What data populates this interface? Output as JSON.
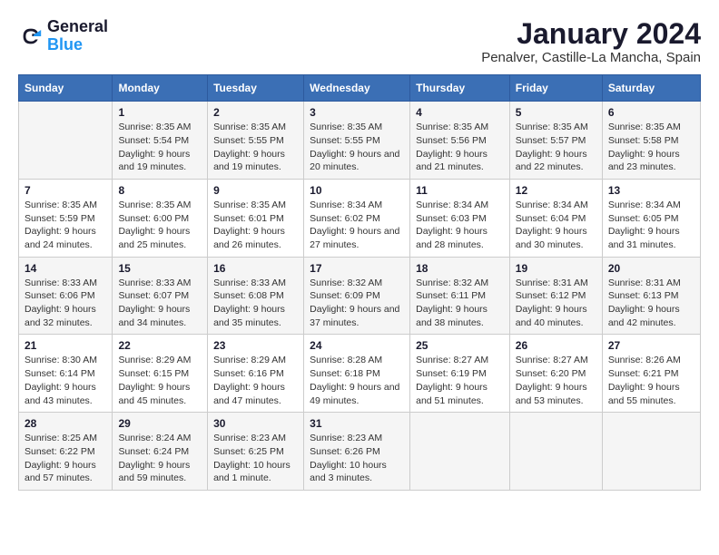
{
  "header": {
    "logo_general": "General",
    "logo_blue": "Blue",
    "title": "January 2024",
    "location": "Penalver, Castille-La Mancha, Spain"
  },
  "calendar": {
    "days_of_week": [
      "Sunday",
      "Monday",
      "Tuesday",
      "Wednesday",
      "Thursday",
      "Friday",
      "Saturday"
    ],
    "weeks": [
      [
        {
          "day": "",
          "sunrise": "",
          "sunset": "",
          "daylight": ""
        },
        {
          "day": "1",
          "sunrise": "Sunrise: 8:35 AM",
          "sunset": "Sunset: 5:54 PM",
          "daylight": "Daylight: 9 hours and 19 minutes."
        },
        {
          "day": "2",
          "sunrise": "Sunrise: 8:35 AM",
          "sunset": "Sunset: 5:55 PM",
          "daylight": "Daylight: 9 hours and 19 minutes."
        },
        {
          "day": "3",
          "sunrise": "Sunrise: 8:35 AM",
          "sunset": "Sunset: 5:55 PM",
          "daylight": "Daylight: 9 hours and 20 minutes."
        },
        {
          "day": "4",
          "sunrise": "Sunrise: 8:35 AM",
          "sunset": "Sunset: 5:56 PM",
          "daylight": "Daylight: 9 hours and 21 minutes."
        },
        {
          "day": "5",
          "sunrise": "Sunrise: 8:35 AM",
          "sunset": "Sunset: 5:57 PM",
          "daylight": "Daylight: 9 hours and 22 minutes."
        },
        {
          "day": "6",
          "sunrise": "Sunrise: 8:35 AM",
          "sunset": "Sunset: 5:58 PM",
          "daylight": "Daylight: 9 hours and 23 minutes."
        }
      ],
      [
        {
          "day": "7",
          "sunrise": "Sunrise: 8:35 AM",
          "sunset": "Sunset: 5:59 PM",
          "daylight": "Daylight: 9 hours and 24 minutes."
        },
        {
          "day": "8",
          "sunrise": "Sunrise: 8:35 AM",
          "sunset": "Sunset: 6:00 PM",
          "daylight": "Daylight: 9 hours and 25 minutes."
        },
        {
          "day": "9",
          "sunrise": "Sunrise: 8:35 AM",
          "sunset": "Sunset: 6:01 PM",
          "daylight": "Daylight: 9 hours and 26 minutes."
        },
        {
          "day": "10",
          "sunrise": "Sunrise: 8:34 AM",
          "sunset": "Sunset: 6:02 PM",
          "daylight": "Daylight: 9 hours and 27 minutes."
        },
        {
          "day": "11",
          "sunrise": "Sunrise: 8:34 AM",
          "sunset": "Sunset: 6:03 PM",
          "daylight": "Daylight: 9 hours and 28 minutes."
        },
        {
          "day": "12",
          "sunrise": "Sunrise: 8:34 AM",
          "sunset": "Sunset: 6:04 PM",
          "daylight": "Daylight: 9 hours and 30 minutes."
        },
        {
          "day": "13",
          "sunrise": "Sunrise: 8:34 AM",
          "sunset": "Sunset: 6:05 PM",
          "daylight": "Daylight: 9 hours and 31 minutes."
        }
      ],
      [
        {
          "day": "14",
          "sunrise": "Sunrise: 8:33 AM",
          "sunset": "Sunset: 6:06 PM",
          "daylight": "Daylight: 9 hours and 32 minutes."
        },
        {
          "day": "15",
          "sunrise": "Sunrise: 8:33 AM",
          "sunset": "Sunset: 6:07 PM",
          "daylight": "Daylight: 9 hours and 34 minutes."
        },
        {
          "day": "16",
          "sunrise": "Sunrise: 8:33 AM",
          "sunset": "Sunset: 6:08 PM",
          "daylight": "Daylight: 9 hours and 35 minutes."
        },
        {
          "day": "17",
          "sunrise": "Sunrise: 8:32 AM",
          "sunset": "Sunset: 6:09 PM",
          "daylight": "Daylight: 9 hours and 37 minutes."
        },
        {
          "day": "18",
          "sunrise": "Sunrise: 8:32 AM",
          "sunset": "Sunset: 6:11 PM",
          "daylight": "Daylight: 9 hours and 38 minutes."
        },
        {
          "day": "19",
          "sunrise": "Sunrise: 8:31 AM",
          "sunset": "Sunset: 6:12 PM",
          "daylight": "Daylight: 9 hours and 40 minutes."
        },
        {
          "day": "20",
          "sunrise": "Sunrise: 8:31 AM",
          "sunset": "Sunset: 6:13 PM",
          "daylight": "Daylight: 9 hours and 42 minutes."
        }
      ],
      [
        {
          "day": "21",
          "sunrise": "Sunrise: 8:30 AM",
          "sunset": "Sunset: 6:14 PM",
          "daylight": "Daylight: 9 hours and 43 minutes."
        },
        {
          "day": "22",
          "sunrise": "Sunrise: 8:29 AM",
          "sunset": "Sunset: 6:15 PM",
          "daylight": "Daylight: 9 hours and 45 minutes."
        },
        {
          "day": "23",
          "sunrise": "Sunrise: 8:29 AM",
          "sunset": "Sunset: 6:16 PM",
          "daylight": "Daylight: 9 hours and 47 minutes."
        },
        {
          "day": "24",
          "sunrise": "Sunrise: 8:28 AM",
          "sunset": "Sunset: 6:18 PM",
          "daylight": "Daylight: 9 hours and 49 minutes."
        },
        {
          "day": "25",
          "sunrise": "Sunrise: 8:27 AM",
          "sunset": "Sunset: 6:19 PM",
          "daylight": "Daylight: 9 hours and 51 minutes."
        },
        {
          "day": "26",
          "sunrise": "Sunrise: 8:27 AM",
          "sunset": "Sunset: 6:20 PM",
          "daylight": "Daylight: 9 hours and 53 minutes."
        },
        {
          "day": "27",
          "sunrise": "Sunrise: 8:26 AM",
          "sunset": "Sunset: 6:21 PM",
          "daylight": "Daylight: 9 hours and 55 minutes."
        }
      ],
      [
        {
          "day": "28",
          "sunrise": "Sunrise: 8:25 AM",
          "sunset": "Sunset: 6:22 PM",
          "daylight": "Daylight: 9 hours and 57 minutes."
        },
        {
          "day": "29",
          "sunrise": "Sunrise: 8:24 AM",
          "sunset": "Sunset: 6:24 PM",
          "daylight": "Daylight: 9 hours and 59 minutes."
        },
        {
          "day": "30",
          "sunrise": "Sunrise: 8:23 AM",
          "sunset": "Sunset: 6:25 PM",
          "daylight": "Daylight: 10 hours and 1 minute."
        },
        {
          "day": "31",
          "sunrise": "Sunrise: 8:23 AM",
          "sunset": "Sunset: 6:26 PM",
          "daylight": "Daylight: 10 hours and 3 minutes."
        },
        {
          "day": "",
          "sunrise": "",
          "sunset": "",
          "daylight": ""
        },
        {
          "day": "",
          "sunrise": "",
          "sunset": "",
          "daylight": ""
        },
        {
          "day": "",
          "sunrise": "",
          "sunset": "",
          "daylight": ""
        }
      ]
    ]
  }
}
